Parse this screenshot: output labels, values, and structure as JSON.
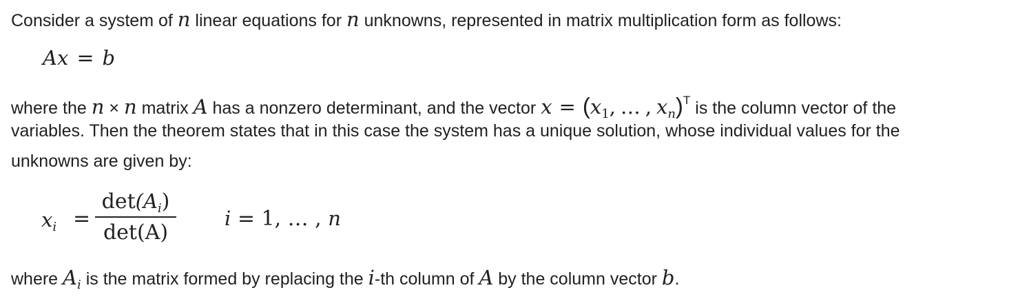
{
  "para1": {
    "t1": "Consider a system of ",
    "t2": " linear equations for ",
    "t3": " unknowns, represented in matrix multiplication form as follows:"
  },
  "eq1": {
    "lhs": "Ax",
    "op": "=",
    "rhs": "b"
  },
  "para2": {
    "t1": "where the ",
    "t2": " matrix ",
    "t3": " has a nonzero determinant, and the vector ",
    "t4": " is the column vector of the",
    "line2": "variables. Then the theorem states that in this case the system has a unique solution, whose individual values for the",
    "line3": "unknowns are given by:",
    "x": "x",
    "A": "A",
    "times": "×",
    "eq": "=",
    "lparen": "(",
    "rparen": ")",
    "x1": "x",
    "sub1": "1",
    "comma1": ",",
    "dots": "…",
    "comma2": ",",
    "xn": "x",
    "subn": "n",
    "sup_T": "T"
  },
  "eq2": {
    "lhs": "x",
    "lhs_sub": "i",
    "op": "=",
    "num_fn": "det",
    "num_arg": "(A",
    "num_sub": "i",
    "num_close": ")",
    "den": "det(A)",
    "range_var": "i",
    "range_rest": " = 1, … , ",
    "range_n": "n"
  },
  "para3": {
    "t1": "where ",
    "A": "A",
    "A_sub": "i",
    "t2": " is the matrix formed by replacing the ",
    "i": "i",
    "t3": "-th column of ",
    "A2": "A",
    "t4": " by the column vector ",
    "b": "b",
    "t5": "."
  },
  "symbols": {
    "n": "n"
  }
}
